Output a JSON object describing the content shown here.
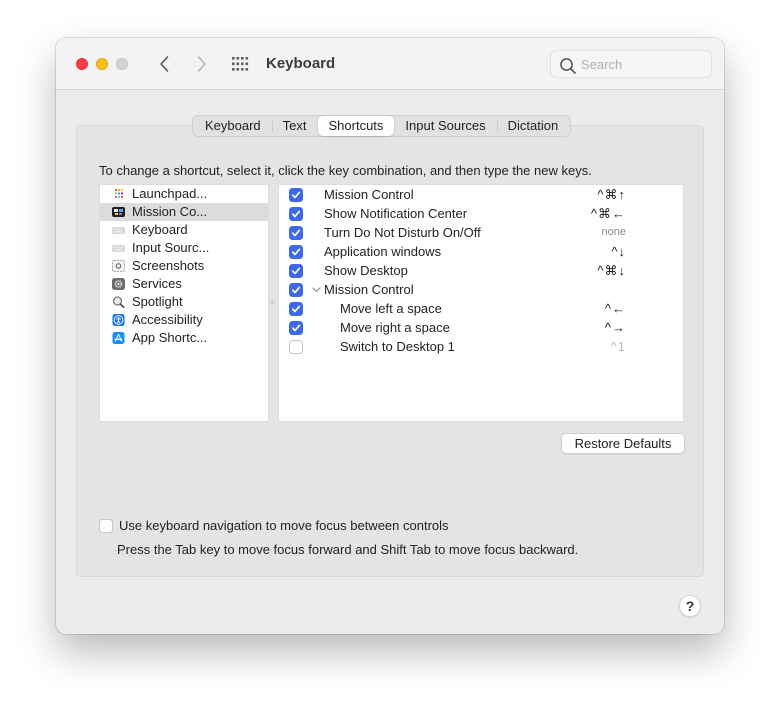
{
  "window": {
    "title": "Keyboard",
    "traffic_lights": {
      "close": "#fe3c45",
      "minimize": "#fdbd17",
      "zoom": "#d3d3d5"
    }
  },
  "toolbar": {
    "back_icon": "chevron-left",
    "forward_icon": "chevron-right",
    "show_all_icon": "grid-dots",
    "search": {
      "placeholder": "Search",
      "value": ""
    }
  },
  "tabs": [
    {
      "label": "Keyboard",
      "active": false
    },
    {
      "label": "Text",
      "active": false
    },
    {
      "label": "Shortcuts",
      "active": true
    },
    {
      "label": "Input Sources",
      "active": false
    },
    {
      "label": "Dictation",
      "active": false
    }
  ],
  "instructions": "To change a shortcut, select it, click the key combination, and then type the new keys.",
  "categories": [
    {
      "label": "Launchpad...",
      "icon": "launchpad",
      "selected": false
    },
    {
      "label": "Mission Co...",
      "icon": "mission-control",
      "selected": true
    },
    {
      "label": "Keyboard",
      "icon": "keyboard",
      "selected": false
    },
    {
      "label": "Input Sourc...",
      "icon": "keyboard",
      "selected": false
    },
    {
      "label": "Screenshots",
      "icon": "screenshot",
      "selected": false
    },
    {
      "label": "Services",
      "icon": "gear",
      "selected": false
    },
    {
      "label": "Spotlight",
      "icon": "magnifier",
      "selected": false
    },
    {
      "label": "Accessibility",
      "icon": "accessibility",
      "selected": false
    },
    {
      "label": "App Shortc...",
      "icon": "app-store",
      "selected": false
    }
  ],
  "shortcuts": [
    {
      "label": "Mission Control",
      "checked": true,
      "keys": "^⌘↑",
      "indent": 0
    },
    {
      "label": "Show Notification Center",
      "checked": true,
      "keys": "^⌘←",
      "indent": 0
    },
    {
      "label": "Turn Do Not Disturb On/Off",
      "checked": true,
      "keys": "none",
      "indent": 0
    },
    {
      "label": "Application windows",
      "checked": true,
      "keys": "^↓",
      "indent": 0
    },
    {
      "label": "Show Desktop",
      "checked": true,
      "keys": "^⌘↓",
      "indent": 0
    },
    {
      "label": "Mission Control",
      "checked": true,
      "keys": "",
      "indent": 0,
      "expanded": true
    },
    {
      "label": "Move left a space",
      "checked": true,
      "keys": "^←",
      "indent": 1
    },
    {
      "label": "Move right a space",
      "checked": true,
      "keys": "^→",
      "indent": 1
    },
    {
      "label": "Switch to Desktop 1",
      "checked": false,
      "keys": "^1",
      "indent": 1
    }
  ],
  "restore_defaults_label": "Restore Defaults",
  "keyboard_navigation": {
    "label": "Use keyboard navigation to move focus between controls",
    "checked": false,
    "help": "Press the Tab key to move focus forward and Shift Tab to move focus backward."
  },
  "help_button_label": "?",
  "colors": {
    "accent": "#3e67e9",
    "selection": "#dcdcdc"
  }
}
